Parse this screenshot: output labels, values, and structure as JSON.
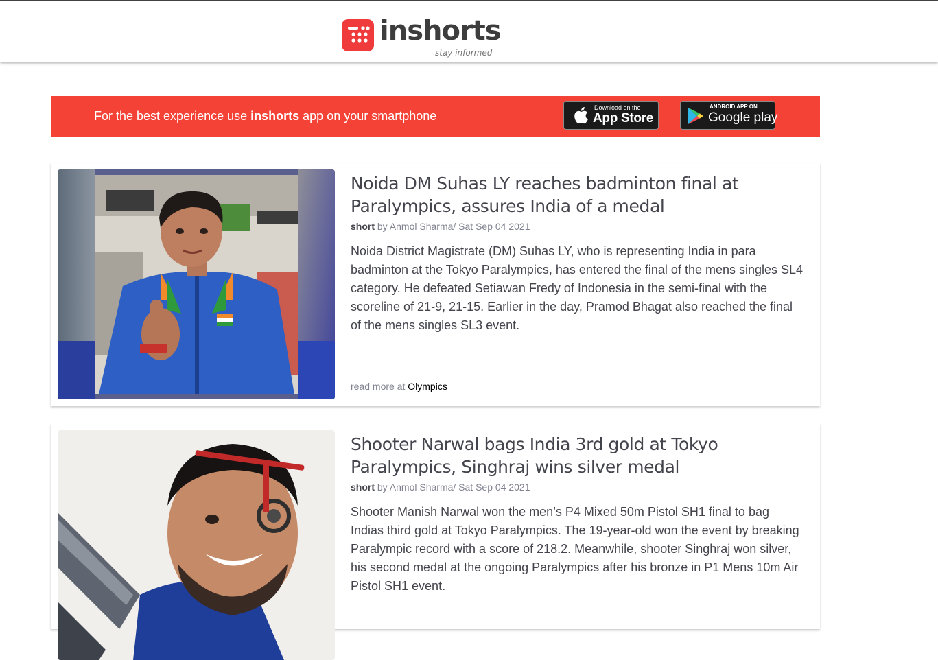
{
  "header": {
    "logo_text": "inshorts",
    "tagline": "stay informed"
  },
  "banner": {
    "text_prefix": "For the best experience use ",
    "text_brand": "inshorts",
    "text_suffix": " app on your smartphone",
    "appstore_small": "Download on the",
    "appstore_big": "App Store",
    "gplay_small": "ANDROID APP ON",
    "gplay_big": "Google play"
  },
  "colors": {
    "brand_red": "#f44336",
    "logo_red": "#ef3b3b"
  },
  "articles": [
    {
      "title": "Noida DM Suhas LY reaches badminton final at Paralympics, assures India of a medal",
      "tag": "short",
      "by": " by Anmol Sharma/ Sat Sep 04 2021",
      "body": "Noida District Magistrate (DM) Suhas LY, who is representing India in para badminton at the Tokyo Paralympics, has entered the final of the mens singles SL4 category. He defeated Setiawan Fredy of Indonesia in the semi-final with the scoreline of 21-9, 21-15. Earlier in the day, Pramod Bhagat also reached the final of the mens singles SL3 event.",
      "read_more_prefix": "read more at ",
      "source": "Olympics"
    },
    {
      "title": "Shooter Narwal bags India 3rd gold at Tokyo Paralympics, Singhraj wins silver medal",
      "tag": "short",
      "by": " by Anmol Sharma/ Sat Sep 04 2021",
      "body": "Shooter Manish Narwal won the men’s P4 Mixed 50m Pistol SH1 final to bag Indias third gold at Tokyo Paralympics. The 19-year-old won the event by breaking Paralympic record with a score of 218.2. Meanwhile, shooter Singhraj won silver, his second medal at the ongoing Paralympics after his bronze in P1 Mens 10m Air Pistol SH1 event."
    }
  ]
}
